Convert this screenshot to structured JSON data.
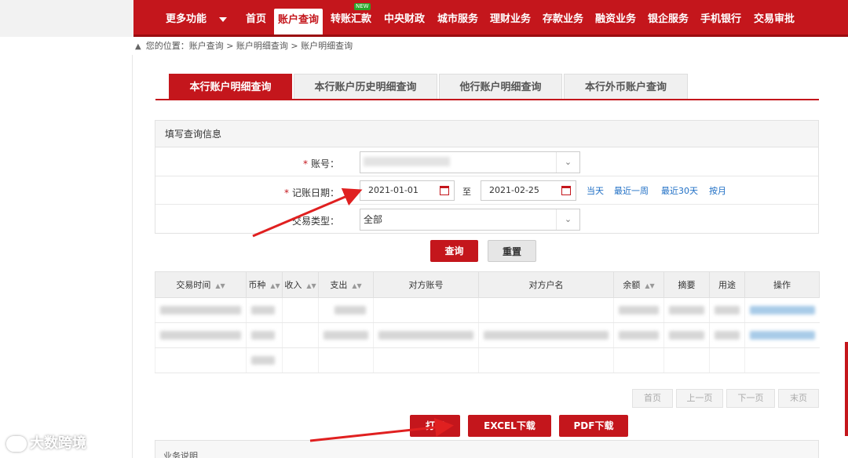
{
  "nav": {
    "more_label": "更多功能",
    "new_badge": "NEW",
    "items": [
      "首页",
      "账户查询",
      "转账汇款",
      "中央财政",
      "城市服务",
      "理财业务",
      "存款业务",
      "融资业务",
      "银企服务",
      "手机银行",
      "交易审批"
    ],
    "active": "账户查询"
  },
  "breadcrumb": "您的位置：账户查询 > 账户明细查询 > 账户明细查询",
  "tabs": [
    "本行账户明细查询",
    "本行账户历史明细查询",
    "他行账户明细查询",
    "本行外币账户查询"
  ],
  "form": {
    "title": "填写查询信息",
    "account_label": "账号：",
    "date_label": "记账日期：",
    "type_label": "交易类型：",
    "date_from": "2021-01-01",
    "date_sep": "至",
    "date_to": "2021-02-25",
    "quick": [
      "当天",
      "最近一周",
      "最近30天",
      "按月"
    ],
    "type_value": "全部",
    "required_mark": "*"
  },
  "buttons": {
    "query": "查询",
    "reset": "重置",
    "print": "打印",
    "excel": "EXCEL下载",
    "pdf": "PDF下载"
  },
  "table": {
    "headers": [
      "交易时间",
      "币种",
      "收入",
      "支出",
      "对方账号",
      "对方户名",
      "余额",
      "摘要",
      "用途",
      "操作"
    ]
  },
  "pager": [
    "首页",
    "上一页",
    "下一页",
    "末页"
  ],
  "notes_title": "业务说明",
  "watermark": "大数跨境",
  "colors": {
    "brand": "#c4161c",
    "link": "#1f6fc5"
  }
}
